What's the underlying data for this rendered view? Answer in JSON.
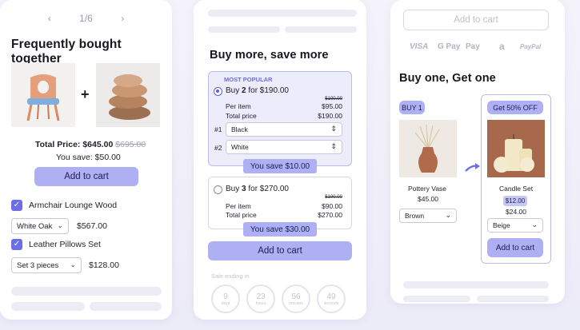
{
  "card1": {
    "pager": {
      "prev": "‹",
      "current": "1/6",
      "next": "›"
    },
    "title": "Frequently bought together",
    "total_label": "Total Price:",
    "total_price": "$645.00",
    "total_original": "$695.00",
    "save_label": "You save:",
    "save_value": "$50.00",
    "add_to_cart": "Add to cart",
    "items": [
      {
        "name": "Armchair Lounge Wood",
        "option": "White Oak",
        "price": "$567.00"
      },
      {
        "name": "Leather Pillows Set",
        "option": "Set 3 pieces",
        "price": "$128.00"
      }
    ]
  },
  "card2": {
    "title": "Buy more, save more",
    "most_popular": "MOST POPULAR",
    "offers": [
      {
        "buy_prefix": "Buy ",
        "qty": "2",
        "buy_suffix": " for $190.00",
        "original": "$100.00",
        "per_item_label": "Per item",
        "per_item": "$95.00",
        "total_label": "Total price",
        "total": "$190.00",
        "variants": [
          {
            "index": "#1",
            "value": "Black"
          },
          {
            "index": "#2",
            "value": "White"
          }
        ],
        "save": "You save $10.00"
      },
      {
        "buy_prefix": "Buy ",
        "qty": "3",
        "buy_suffix": " for $270.00",
        "original": "$100.00",
        "per_item_label": "Per item",
        "per_item": "$90.00",
        "total_label": "Total price",
        "total": "$270.00",
        "save": "You save $30.00"
      }
    ],
    "add_to_cart": "Add to cart",
    "sale_label": "Sale ending in",
    "timer": [
      {
        "value": "9",
        "unit": "days"
      },
      {
        "value": "23",
        "unit": "hours"
      },
      {
        "value": "56",
        "unit": "minutes"
      },
      {
        "value": "49",
        "unit": "seconds"
      }
    ]
  },
  "card3": {
    "add_to_cart_top": "Add to cart",
    "payments": [
      "VISA",
      "G Pay",
      "Pay",
      "a",
      "PayPal"
    ],
    "title": "Buy one, Get one",
    "buy_badge": "BUY 1",
    "get_badge": "Get 50% OFF",
    "product1": {
      "name": "Pottery Vase",
      "price": "$45.00",
      "option": "Brown"
    },
    "product2": {
      "name": "Candle Set",
      "price": "$12.00",
      "original": "$24.00",
      "option": "Beige"
    },
    "add_to_cart": "Add to cart"
  },
  "colors": {
    "accent": "#aeb0f3",
    "accent_dark": "#6b6ee8",
    "offer_bg": "#ececfb",
    "background": "#f1f0fa"
  }
}
